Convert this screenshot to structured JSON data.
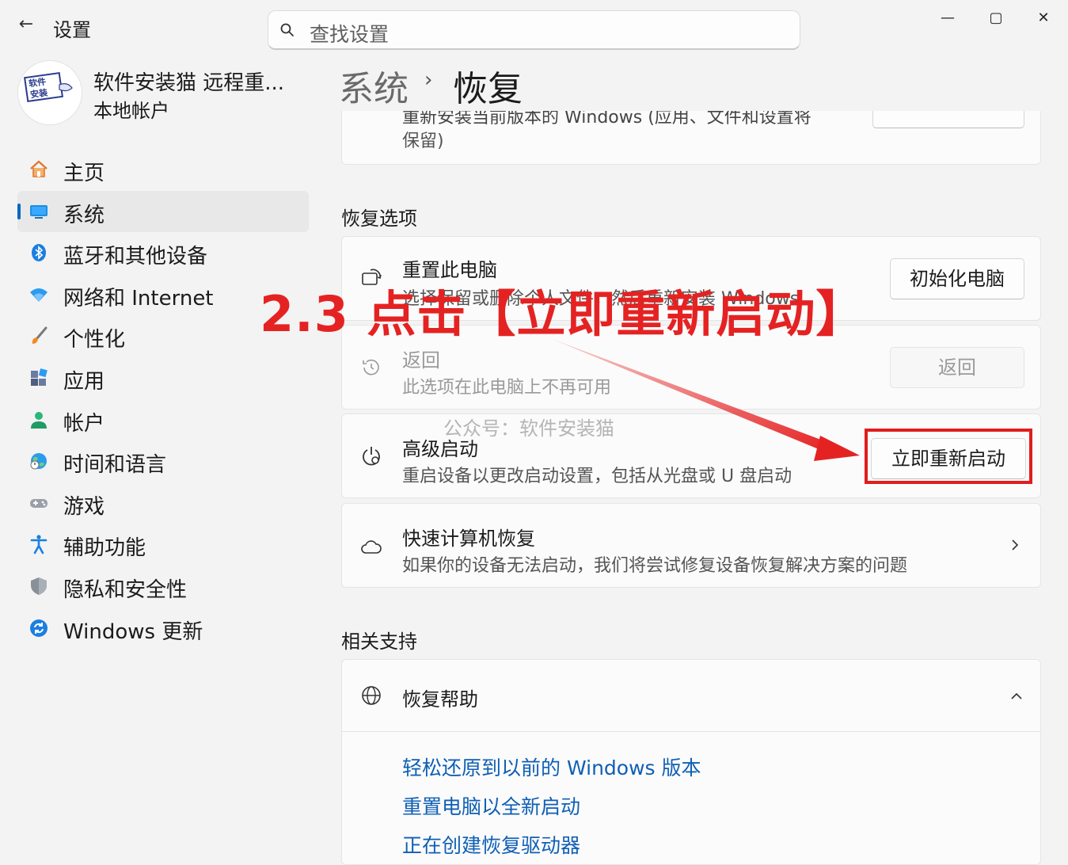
{
  "window": {
    "app_title": "设置",
    "back_glyph": "←"
  },
  "window_controls": {
    "minimize": "—",
    "maximize": "▢",
    "close": "✕"
  },
  "search": {
    "placeholder": "查找设置"
  },
  "profile": {
    "name": "软件安装猫 远程重...",
    "account_type": "本地帐户",
    "avatar_text_1": "软件",
    "avatar_text_2": "安装"
  },
  "nav": {
    "items": [
      {
        "label": "主页",
        "icon": "home-icon",
        "active": false
      },
      {
        "label": "系统",
        "icon": "system-icon",
        "active": true
      },
      {
        "label": "蓝牙和其他设备",
        "icon": "bluetooth-icon",
        "active": false
      },
      {
        "label": "网络和 Internet",
        "icon": "wifi-icon",
        "active": false
      },
      {
        "label": "个性化",
        "icon": "brush-icon",
        "active": false
      },
      {
        "label": "应用",
        "icon": "apps-icon",
        "active": false
      },
      {
        "label": "帐户",
        "icon": "account-icon",
        "active": false
      },
      {
        "label": "时间和语言",
        "icon": "globe-icon",
        "active": false
      },
      {
        "label": "游戏",
        "icon": "gamepad-icon",
        "active": false
      },
      {
        "label": "辅助功能",
        "icon": "accessibility-icon",
        "active": false
      },
      {
        "label": "隐私和安全性",
        "icon": "shield-icon",
        "active": false
      },
      {
        "label": "Windows 更新",
        "icon": "update-icon",
        "active": false
      }
    ]
  },
  "breadcrumb": {
    "parent": "系统",
    "separator": "›",
    "current": "恢复"
  },
  "top_card": {
    "desc_cut": "重新安装当前版本的 Windows (应用、文件和设置将",
    "desc_line2": "保留)"
  },
  "recovery_options": {
    "title": "恢复选项",
    "reset": {
      "title": "重置此电脑",
      "desc": "选择保留或删除个人文件，然后重新安装 Windows",
      "button": "初始化电脑"
    },
    "goback": {
      "title": "返回",
      "desc": "此选项在此电脑上不再可用",
      "button": "返回"
    },
    "advanced": {
      "title": "高级启动",
      "desc": "重启设备以更改启动设置，包括从光盘或 U 盘启动",
      "button": "立即重新启动"
    },
    "quick": {
      "title": "快速计算机恢复",
      "desc": "如果你的设备无法启动，我们将尝试修复设备恢复解决方案的问题"
    }
  },
  "related": {
    "title": "相关支持",
    "help": {
      "title": "恢复帮助",
      "links": [
        "轻松还原到以前的 Windows 版本",
        "重置电脑以全新启动",
        "正在创建恢复驱动器"
      ]
    }
  },
  "annotation": {
    "text": "2.3 点击【立即重新启动】",
    "watermark": "公众号：软件安装猫"
  },
  "colors": {
    "accent": "#0067c0",
    "annotation_red": "#e52222",
    "link": "#0f5fb5"
  }
}
